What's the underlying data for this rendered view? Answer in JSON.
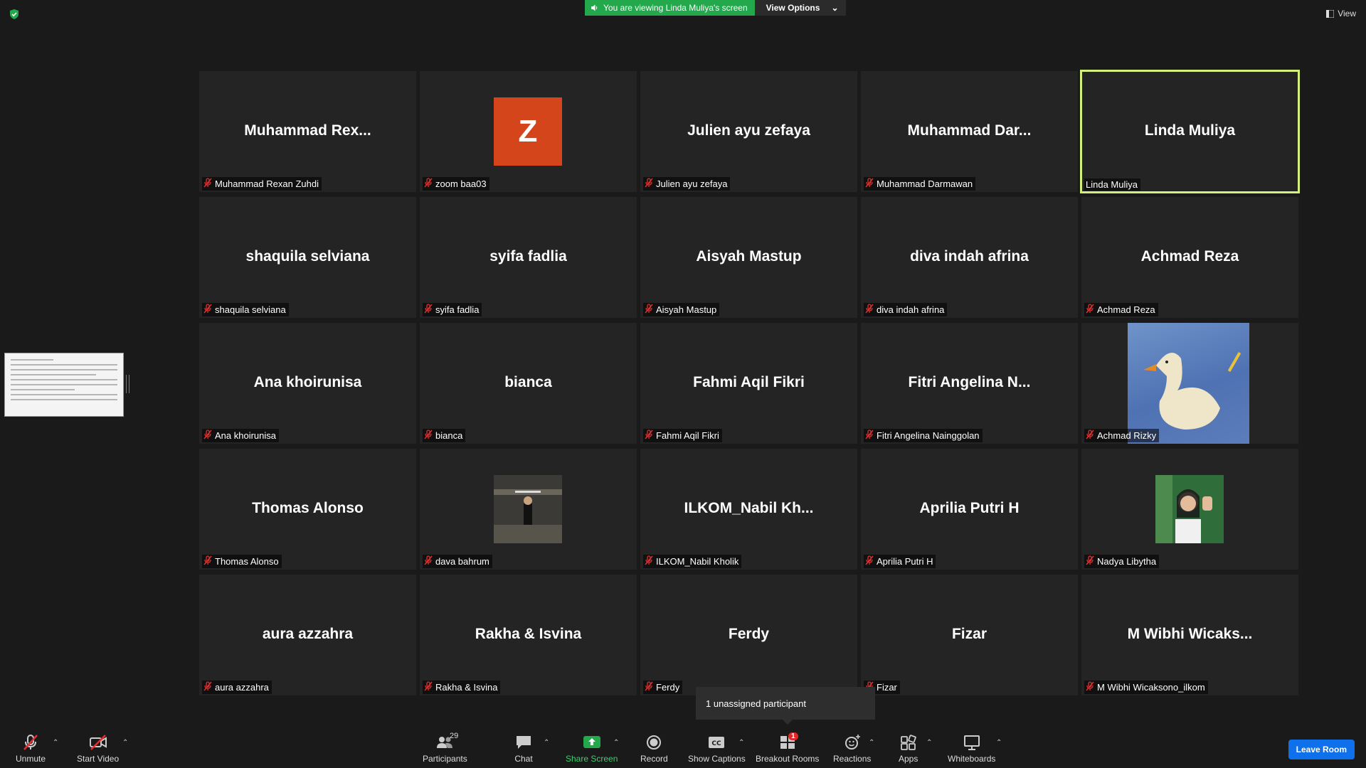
{
  "banner": {
    "viewing_text": "You are viewing Linda Muliya's screen",
    "view_options": "View Options"
  },
  "top_right": {
    "view_label": "View"
  },
  "tiles": [
    {
      "display": "Muhammad  Rex...",
      "label": "Muhammad Rexan Zuhdi",
      "type": "name"
    },
    {
      "display": "Z",
      "label": "zoom baa03",
      "type": "avatar"
    },
    {
      "display": "Julien ayu zefaya",
      "label": "Julien ayu zefaya",
      "type": "name"
    },
    {
      "display": "Muhammad  Dar...",
      "label": "Muhammad Darmawan",
      "type": "name"
    },
    {
      "display": "Linda Muliya",
      "label": "Linda Muliya",
      "type": "name",
      "active": true
    },
    {
      "display": "shaquila selviana",
      "label": "shaquila selviana",
      "type": "name"
    },
    {
      "display": "syifa fadlia",
      "label": "syifa fadlia",
      "type": "name"
    },
    {
      "display": "Aisyah Mastup",
      "label": "Aisyah Mastup",
      "type": "name"
    },
    {
      "display": "diva indah afrina",
      "label": "diva indah afrina",
      "type": "name"
    },
    {
      "display": "Achmad Reza",
      "label": "Achmad Reza",
      "type": "name"
    },
    {
      "display": "Ana khoirunisa",
      "label": "Ana khoirunisa",
      "type": "name"
    },
    {
      "display": "bianca",
      "label": "bianca",
      "type": "name"
    },
    {
      "display": "Fahmi Aqil Fikri",
      "label": "Fahmi Aqil Fikri",
      "type": "name"
    },
    {
      "display": "Fitri  Angelina  N...",
      "label": "Fitri Angelina Nainggolan",
      "type": "name"
    },
    {
      "display": "",
      "label": "Achmad Rizky",
      "type": "video"
    },
    {
      "display": "Thomas Alonso",
      "label": "Thomas Alonso",
      "type": "name"
    },
    {
      "display": "",
      "label": "dava bahrum",
      "type": "photo-dark"
    },
    {
      "display": "ILKOM_Nabil  Kh...",
      "label": "ILKOM_Nabil Kholik",
      "type": "name"
    },
    {
      "display": "Aprilia Putri H",
      "label": "Aprilia Putri H",
      "type": "name"
    },
    {
      "display": "",
      "label": "Nadya Libytha",
      "type": "photo-green"
    },
    {
      "display": "aura azzahra",
      "label": "aura azzahra",
      "type": "name"
    },
    {
      "display": "Rakha & Isvina",
      "label": "Rakha & Isvina",
      "type": "name"
    },
    {
      "display": "Ferdy",
      "label": "Ferdy",
      "type": "name"
    },
    {
      "display": "Fizar",
      "label": "Fizar",
      "type": "name"
    },
    {
      "display": "M  Wibhi  Wicaks...",
      "label": "M Wibhi Wicaksono_ilkom",
      "type": "name"
    }
  ],
  "popup": {
    "text": "1 unassigned participant"
  },
  "toolbar": {
    "unmute": "Unmute",
    "start_video": "Start Video",
    "participants": "Participants",
    "participants_count": "29",
    "chat": "Chat",
    "share_screen": "Share Screen",
    "record": "Record",
    "show_captions": "Show Captions",
    "breakout_rooms": "Breakout Rooms",
    "breakout_badge": "1",
    "reactions": "Reactions",
    "apps": "Apps",
    "whiteboards": "Whiteboards",
    "leave_room": "Leave Room"
  },
  "colors": {
    "accent_green": "#23a84b",
    "active_border": "#d4f07a",
    "leave_blue": "#0e71eb",
    "avatar_orange": "#d5451c"
  }
}
